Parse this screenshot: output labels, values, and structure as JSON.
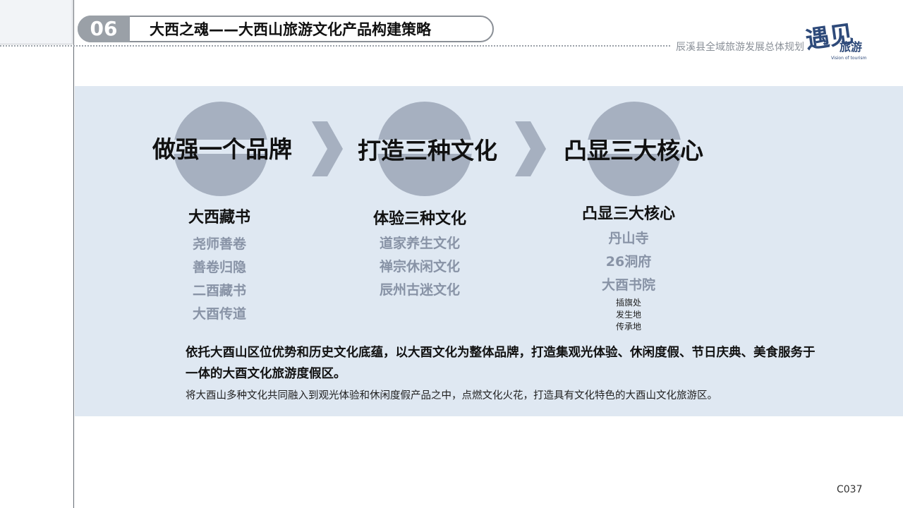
{
  "header": {
    "section_number": "06",
    "section_title": "大西之魂——大西山旅游文化产品构建策略",
    "plan_title": "辰溪县全域旅游发展总体规划",
    "logo": {
      "calligraphy": "遇见",
      "text": "旅游",
      "tagline": "Vision of tourism"
    }
  },
  "strategies": [
    {
      "title": "做强一个品牌",
      "heading": "大西藏书",
      "items": [
        "尧师善卷",
        "善卷归隐",
        "二酉藏书",
        "大酉传道"
      ],
      "notes": []
    },
    {
      "title": "打造三种文化",
      "heading": "体验三种文化",
      "items": [
        "道家养生文化",
        "禅宗休闲文化",
        "辰州古迷文化"
      ],
      "notes": []
    },
    {
      "title": "凸显三大核心",
      "heading": "凸显三大核心",
      "items": [
        "丹山寺",
        "26洞府",
        "大酉书院"
      ],
      "notes": [
        "插旗处",
        "发生地",
        "传承地"
      ]
    }
  ],
  "summary": {
    "bold": "依托大酉山区位优势和历史文化底蕴，以大酉文化为整体品牌，打造集观光体验、休闲度假、节日庆典、美食服务于一体的大酉文化旅游度假区。",
    "normal": "将大酉山多种文化共同融入到观光体验和休闲度假产品之中，点燃文化火花，打造具有文化特色的大酉山文化旅游区。"
  },
  "page_code": "C037",
  "colors": {
    "panel": "#dfe8f2",
    "circle": "#a6b0c0",
    "chevron": "#a6b0c0",
    "sub_text": "#8893a6",
    "number_badge": "#9aa0a7",
    "logo_blue": "#2e4a7a"
  }
}
